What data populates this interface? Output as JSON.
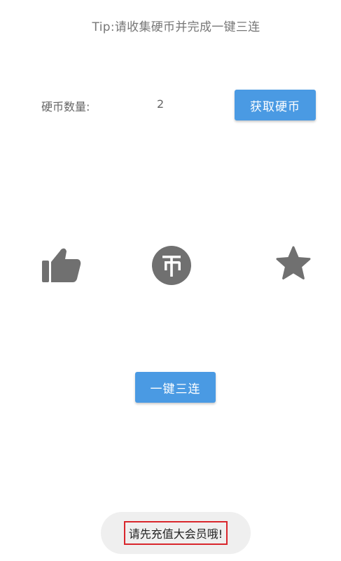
{
  "tip": "Tip:请收集硬币并完成一键三连",
  "coin": {
    "label": "硬币数量:",
    "count": "2"
  },
  "buttons": {
    "get_coin": "获取硬币",
    "triple": "一键三连"
  },
  "icons": [
    "thumb-up-icon",
    "coin-icon",
    "star-icon"
  ],
  "toast": "请先充值大会员哦!",
  "colors": {
    "accent": "#4a9ae3",
    "icon": "#707070",
    "toast_bg": "#efefef",
    "highlight_border": "#d9262c"
  }
}
